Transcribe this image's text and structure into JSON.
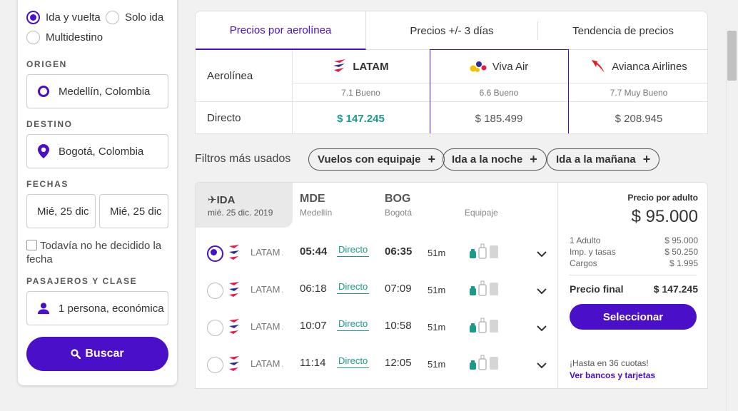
{
  "trip_type": {
    "options": [
      {
        "label": "Ida y vuelta",
        "selected": true
      },
      {
        "label": "Solo ida",
        "selected": false
      },
      {
        "label": "Multidestino",
        "selected": false
      }
    ]
  },
  "origin": {
    "label": "ORIGEN",
    "value": "Medellín, Colombia"
  },
  "destination": {
    "label": "DESTINO",
    "value": "Bogotá, Colombia"
  },
  "dates": {
    "label": "FECHAS",
    "departure": "Mié, 25 dic",
    "return": "Mié, 25 dic"
  },
  "undecided": {
    "label": "Todavía no he decidido la fecha",
    "checked": false
  },
  "passengers": {
    "label": "PASAJEROS Y CLASE",
    "value": "1 persona, económica"
  },
  "search_button": "Buscar",
  "price_tabs": [
    "Precios por aerolínea",
    "Precios +/- 3 días",
    "Tendencia de precios"
  ],
  "airline_table": {
    "row_label_airline": "Aerolínea",
    "row_label_direct": "Directo",
    "airlines": [
      {
        "name": "LATAM",
        "rating": "7.1 Bueno",
        "price": "$ 147.245",
        "highlight": true
      },
      {
        "name": "Viva Air",
        "rating": "6.6 Bueno",
        "price": "$ 185.499",
        "highlight": false
      },
      {
        "name": "Avianca Airlines",
        "rating": "7.7 Muy Bueno",
        "price": "$ 208.945",
        "highlight": false
      }
    ]
  },
  "filters": {
    "label": "Filtros más usados",
    "chips": [
      "Vuelos con equipaje",
      "Ida a la noche",
      "Ida a la mañana"
    ]
  },
  "results": {
    "direction": "✈IDA",
    "date": "mié. 25 dic. 2019",
    "origin_code": "MDE",
    "origin_city": "Medellín",
    "dest_code": "BOG",
    "dest_city": "Bogotá",
    "luggage_label": "Equipaje",
    "flights": [
      {
        "airline": "LATAM Airlines",
        "depart": "05:44",
        "stops": "Directo",
        "arrive": "06:35",
        "duration": "51m",
        "selected": true
      },
      {
        "airline": "LATAM Airlines",
        "depart": "06:18",
        "stops": "Directo",
        "arrive": "07:09",
        "duration": "51m",
        "selected": false
      },
      {
        "airline": "LATAM Airlines",
        "depart": "10:07",
        "stops": "Directo",
        "arrive": "10:58",
        "duration": "51m",
        "selected": false
      },
      {
        "airline": "LATAM Airlines",
        "depart": "11:14",
        "stops": "Directo",
        "arrive": "12:05",
        "duration": "51m",
        "selected": false
      }
    ]
  },
  "price_summary": {
    "label": "Precio por adulto",
    "amount": "$ 95.000",
    "lines": [
      {
        "label": "1 Adulto",
        "value": "$ 95.000"
      },
      {
        "label": "Imp. y tasas",
        "value": "$ 50.250"
      },
      {
        "label": "Cargos",
        "value": "$ 1.995"
      }
    ],
    "final_label": "Precio final",
    "final_value": "$ 147.245",
    "select_button": "Seleccionar",
    "installments": "¡Hasta en 36 cuotas!",
    "banks_link": "Ver bancos y tarjetas"
  },
  "colors": {
    "accent": "#4a0fc8",
    "green": "#1a9a8a"
  }
}
